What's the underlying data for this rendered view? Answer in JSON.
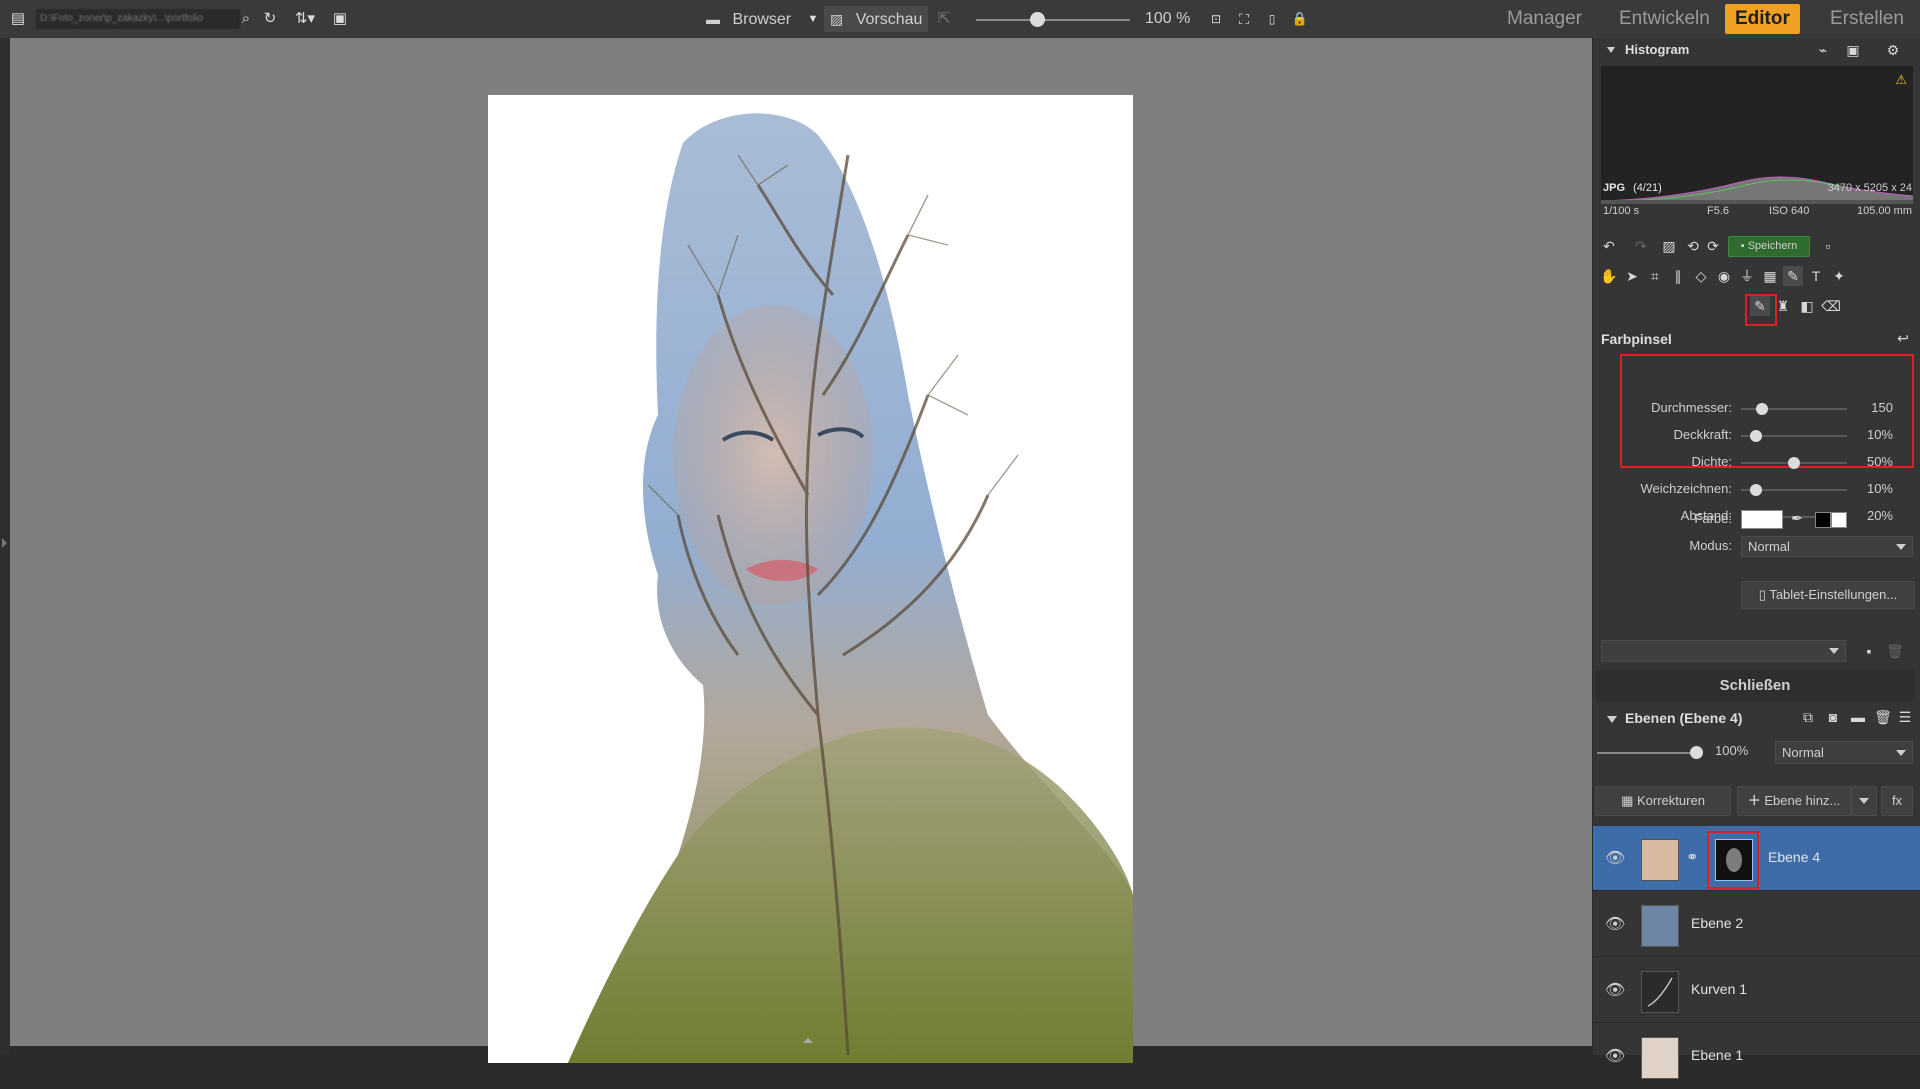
{
  "topbar": {
    "path": "D:\\Foto_zoner\\p_zakazky\\...\\portfolio",
    "browser_label": "Browser",
    "preview_label": "Vorschau",
    "zoom": "100 %",
    "nav_tabs": [
      "Manager",
      "Entwickeln",
      "Editor",
      "Erstellen"
    ],
    "active_tab": "Editor"
  },
  "histogram": {
    "title": "Histogram",
    "file_type": "JPG",
    "file_index": "(4/21)",
    "dimensions": "3470 x 5205 x 24",
    "shutter": "1/100 s",
    "aperture": "F5.6",
    "iso": "ISO 640",
    "focal": "105.00 mm"
  },
  "toolbar": {
    "save_label": "Speichern"
  },
  "brush": {
    "title": "Farbpinsel",
    "sliders": [
      {
        "label": "Durchmesser:",
        "value": "150",
        "pos": 0.2
      },
      {
        "label": "Deckkraft:",
        "value": "10%",
        "pos": 0.14
      },
      {
        "label": "Dichte:",
        "value": "50%",
        "pos": 0.5
      },
      {
        "label": "Weichzeichnen:",
        "value": "10%",
        "pos": 0.14
      },
      {
        "label": "Abstand:",
        "value": "20%",
        "pos": 0.23
      }
    ],
    "color_label": "Farbe:",
    "mode_label": "Modus:",
    "mode_value": "Normal",
    "tablet_label": "Tablet-Einstellungen...",
    "close_label": "Schließen"
  },
  "layers": {
    "title": "Ebenen (Ebene 4)",
    "opacity": "100%",
    "blend_mode": "Normal",
    "corrections_label": "Korrekturen",
    "add_layer_label": "Ebene hinz...",
    "fx_label": "fx",
    "items": [
      {
        "name": "Ebene 4"
      },
      {
        "name": "Ebene 2"
      },
      {
        "name": "Kurven 1"
      },
      {
        "name": "Ebene 1"
      }
    ]
  },
  "colors": {
    "accent": "#f0a023",
    "selected_layer": "#3d6ca8",
    "highlight": "#e0201e"
  }
}
